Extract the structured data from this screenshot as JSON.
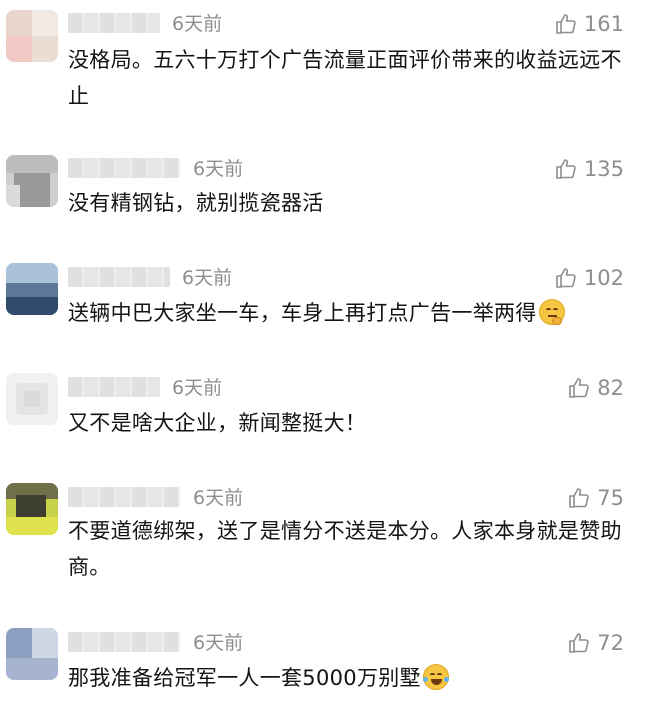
{
  "comments": [
    {
      "time": "6天前",
      "likes": "161",
      "text": "没格局。五六十万打个广告流量正面评价带来的收益远远不止",
      "emoji": ""
    },
    {
      "time": "6天前",
      "likes": "135",
      "text": "没有精钢钻，就别揽瓷器活",
      "emoji": ""
    },
    {
      "time": "6天前",
      "likes": "102",
      "text": "送辆中巴大家坐一车，车身上再打点广告一举两得",
      "emoji": "thinking-face-emoji"
    },
    {
      "time": "6天前",
      "likes": "82",
      "text": "又不是啥大企业，新闻整挺大！",
      "emoji": ""
    },
    {
      "time": "6天前",
      "likes": "75",
      "text": "不要道德绑架，送了是情分不送是本分。人家本身就是赞助商。",
      "emoji": ""
    },
    {
      "time": "6天前",
      "likes": "72",
      "text": "那我准备给冠军一人一套5000万别墅",
      "emoji": "tears-of-joy-emoji"
    }
  ],
  "colors": {
    "meta": "#8e8e8e",
    "text": "#141414"
  },
  "icons": {
    "like": "thumbs-up-icon"
  }
}
